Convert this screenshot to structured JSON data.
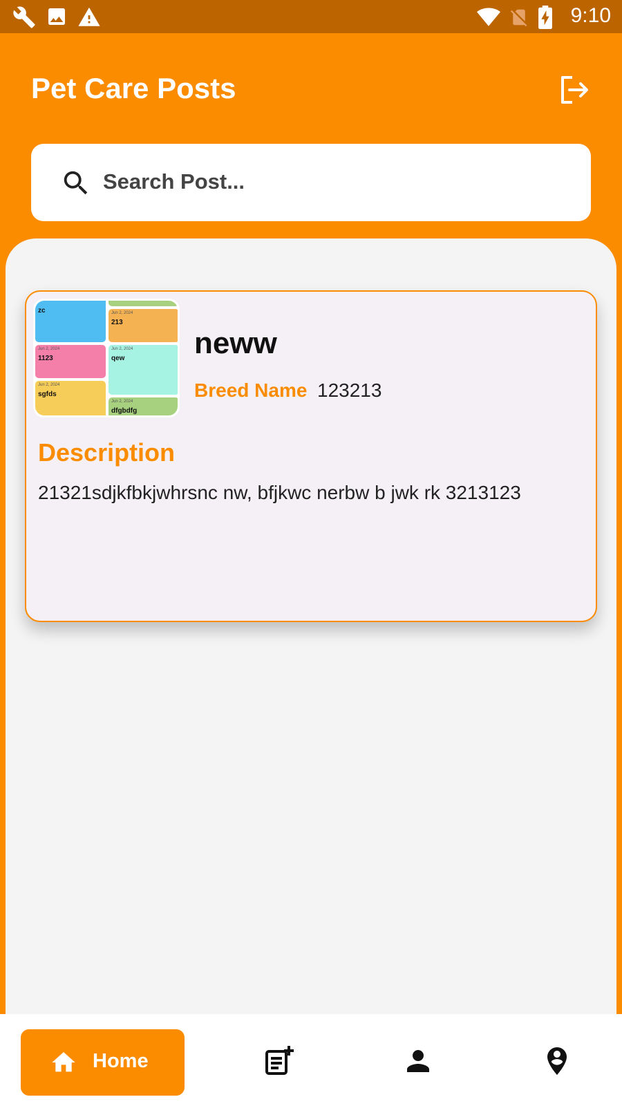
{
  "status_bar": {
    "time": "9:10",
    "left_icons": [
      "wrench-icon",
      "image-icon",
      "warning-icon"
    ],
    "right_icons": [
      "wifi-icon",
      "no-sim-icon",
      "battery-charging-icon"
    ]
  },
  "header": {
    "title": "Pet Care Posts",
    "logout_icon": "logout-icon"
  },
  "search": {
    "placeholder": "Search Post...",
    "icon": "search-icon"
  },
  "posts": [
    {
      "title": "neww",
      "breed_label": "Breed Name",
      "breed_value": "123213",
      "description_label": "Description",
      "description": "21321sdjkfbkjwhrsnc nw, bfjkwc nerbw b jwk rk 3213123",
      "thumbnail_tiles": [
        {
          "date": "",
          "text": "zc",
          "color": "#4fbdf2"
        },
        {
          "date": "Jun 2, 2024",
          "text": "213",
          "color": "#f5b253"
        },
        {
          "date": "Jun 2, 2024",
          "text": "1123",
          "color": "#f47fa8"
        },
        {
          "date": "Jun 2, 2024",
          "text": "qew",
          "color": "#a6f3e4"
        },
        {
          "date": "Jun 2, 2024",
          "text": "sgfds",
          "color": "#f6cd58"
        },
        {
          "date": "Jun 2, 2024",
          "text": "dfgbdfg",
          "color": "#a7d17e"
        }
      ]
    }
  ],
  "bottom_nav": {
    "items": [
      {
        "label": "Home",
        "icon": "home-icon",
        "active": true
      },
      {
        "label": "",
        "icon": "add-post-icon",
        "active": false
      },
      {
        "label": "",
        "icon": "person-icon",
        "active": false
      },
      {
        "label": "",
        "icon": "location-person-icon",
        "active": false
      }
    ]
  },
  "colors": {
    "primary": "#fb8c00",
    "status_bar": "#bc6500",
    "background": "#f4f4f5",
    "card": "#f4f0f6"
  }
}
